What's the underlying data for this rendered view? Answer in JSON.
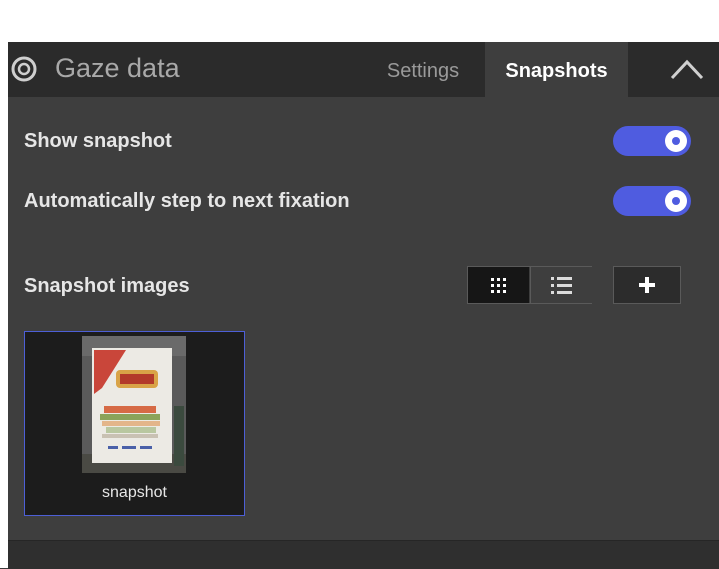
{
  "header": {
    "title": "Gaze data",
    "icon": "target-icon",
    "tabs": [
      {
        "label": "Settings",
        "active": false
      },
      {
        "label": "Snapshots",
        "active": true
      }
    ],
    "collapse_icon": "chevron-up-icon"
  },
  "settings": {
    "show_snapshot": {
      "label": "Show snapshot",
      "enabled": true
    },
    "auto_step": {
      "label": "Automatically step to next fixation",
      "enabled": true
    }
  },
  "snapshot_images": {
    "label": "Snapshot images",
    "view_mode": "grid",
    "view_icons": [
      "grid-icon",
      "list-icon"
    ],
    "add_icon": "plus-icon",
    "items": [
      {
        "name": "snapshot",
        "selected": true
      }
    ]
  },
  "colors": {
    "accent": "#4f5ce0",
    "panel_bg": "#3e3e3e",
    "header_bg": "#2b2b2b",
    "selection_border": "#4d5fd6"
  }
}
